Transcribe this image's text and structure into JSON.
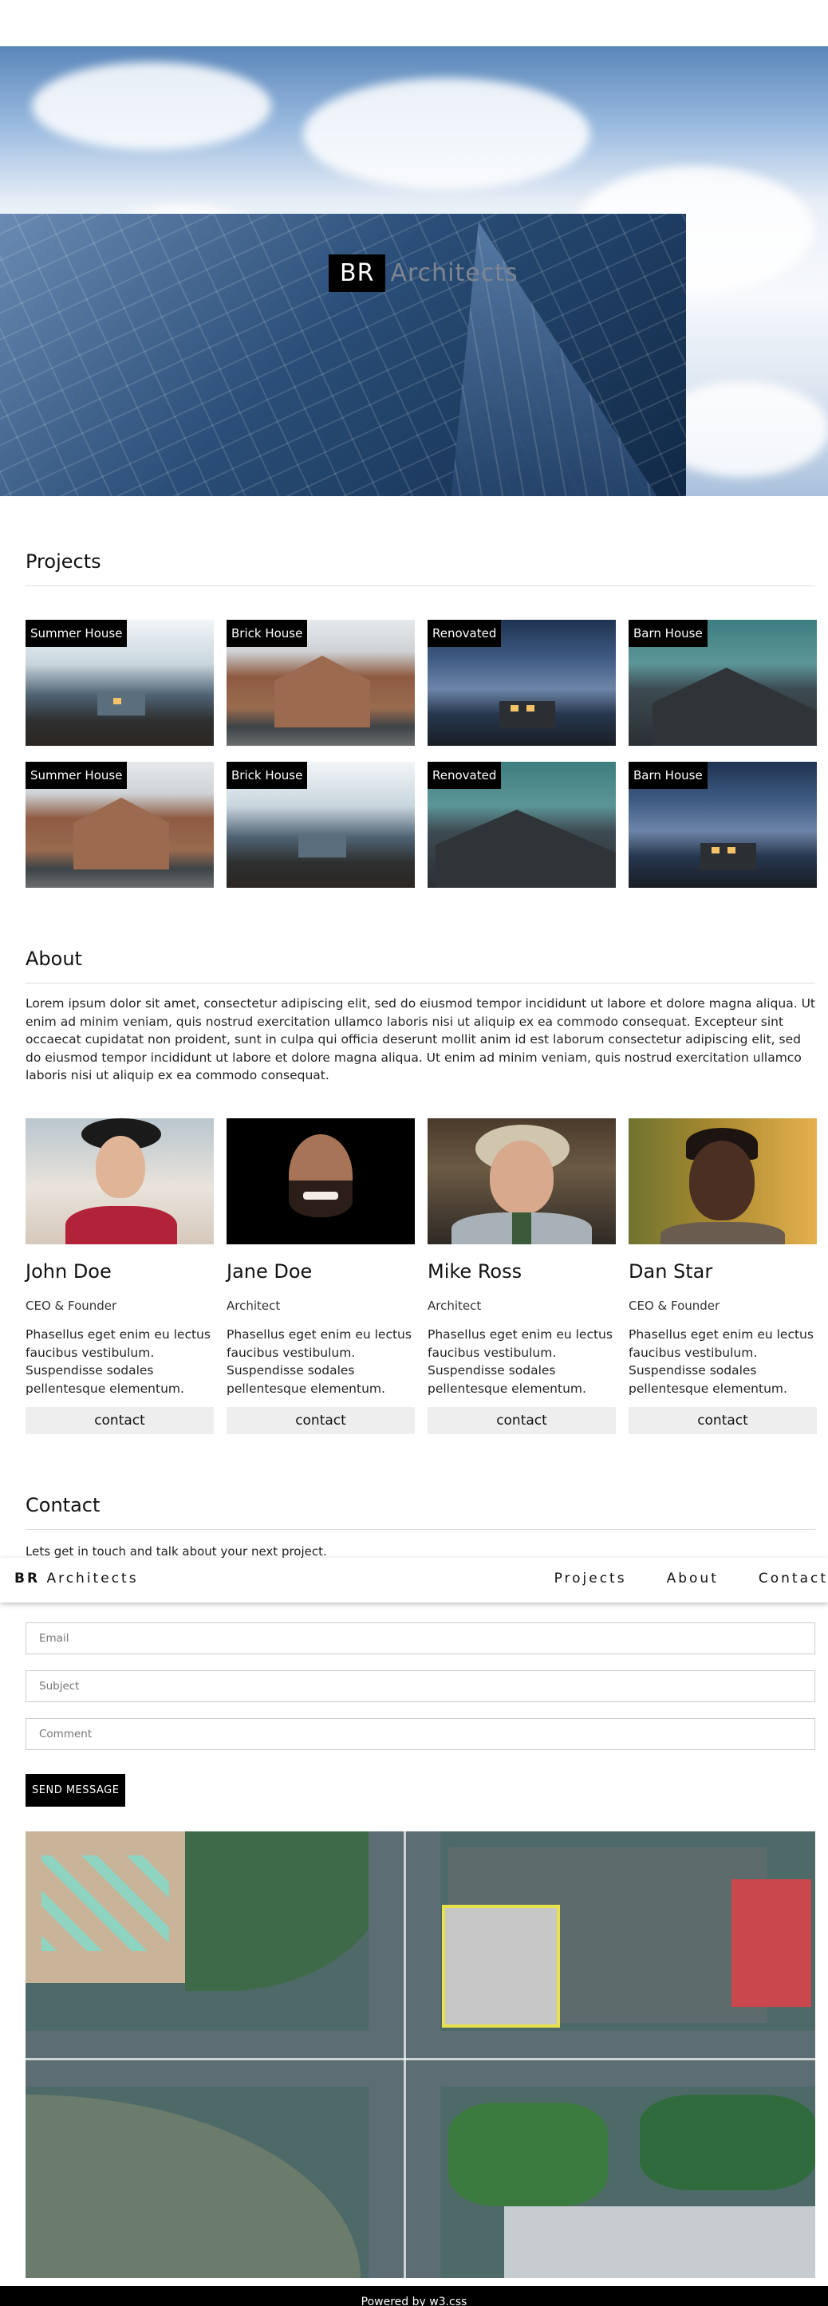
{
  "brand": {
    "short": "BR",
    "name": "Architects"
  },
  "nav": {
    "brand_bold": "BR",
    "brand_rest": "Architects",
    "links": [
      "Projects",
      "About",
      "Contact"
    ]
  },
  "projects": {
    "title": "Projects",
    "items": [
      {
        "label": "Summer House",
        "image": "beach-boardwalk"
      },
      {
        "label": "Brick House",
        "image": "brick-house"
      },
      {
        "label": "Renovated",
        "image": "dusk-cabin"
      },
      {
        "label": "Barn House",
        "image": "barn-house"
      },
      {
        "label": "Summer House",
        "image": "brick-house"
      },
      {
        "label": "Brick House",
        "image": "beach-boardwalk"
      },
      {
        "label": "Renovated",
        "image": "barn-house"
      },
      {
        "label": "Barn House",
        "image": "dusk-cabin"
      }
    ]
  },
  "about": {
    "title": "About",
    "text": "Lorem ipsum dolor sit amet, consectetur adipiscing elit, sed do eiusmod tempor incididunt ut labore et dolore magna aliqua. Ut enim ad minim veniam, quis nostrud exercitation ullamco laboris nisi ut aliquip ex ea commodo consequat. Excepteur sint occaecat cupidatat non proident, sunt in culpa qui officia deserunt mollit anim id est laborum consectetur adipiscing elit, sed do eiusmod tempor incididunt ut labore et dolore magna aliqua. Ut enim ad minim veniam, quis nostrud exercitation ullamco laboris nisi ut aliquip ex ea commodo consequat.",
    "team": [
      {
        "name": "John Doe",
        "role": "CEO & Founder",
        "desc": "Phasellus eget enim eu lectus faucibus vestibulum. Suspendisse sodales pellentesque elementum.",
        "button": "contact"
      },
      {
        "name": "Jane Doe",
        "role": "Architect",
        "desc": "Phasellus eget enim eu lectus faucibus vestibulum. Suspendisse sodales pellentesque elementum.",
        "button": "contact"
      },
      {
        "name": "Mike Ross",
        "role": "Architect",
        "desc": "Phasellus eget enim eu lectus faucibus vestibulum. Suspendisse sodales pellentesque elementum.",
        "button": "contact"
      },
      {
        "name": "Dan Star",
        "role": "CEO & Founder",
        "desc": "Phasellus eget enim eu lectus faucibus vestibulum. Suspendisse sodales pellentesque elementum.",
        "button": "contact"
      }
    ]
  },
  "contact": {
    "title": "Contact",
    "lead": "Lets get in touch and talk about your next project.",
    "fields": {
      "email": "Email",
      "subject": "Subject",
      "comment": "Comment"
    },
    "send_label": "SEND MESSAGE"
  },
  "footer": {
    "text": "Powered by w3.css"
  },
  "colors": {
    "accent": "#000000",
    "button_bg": "#eeeeee",
    "brand_grey": "#7d8590"
  }
}
